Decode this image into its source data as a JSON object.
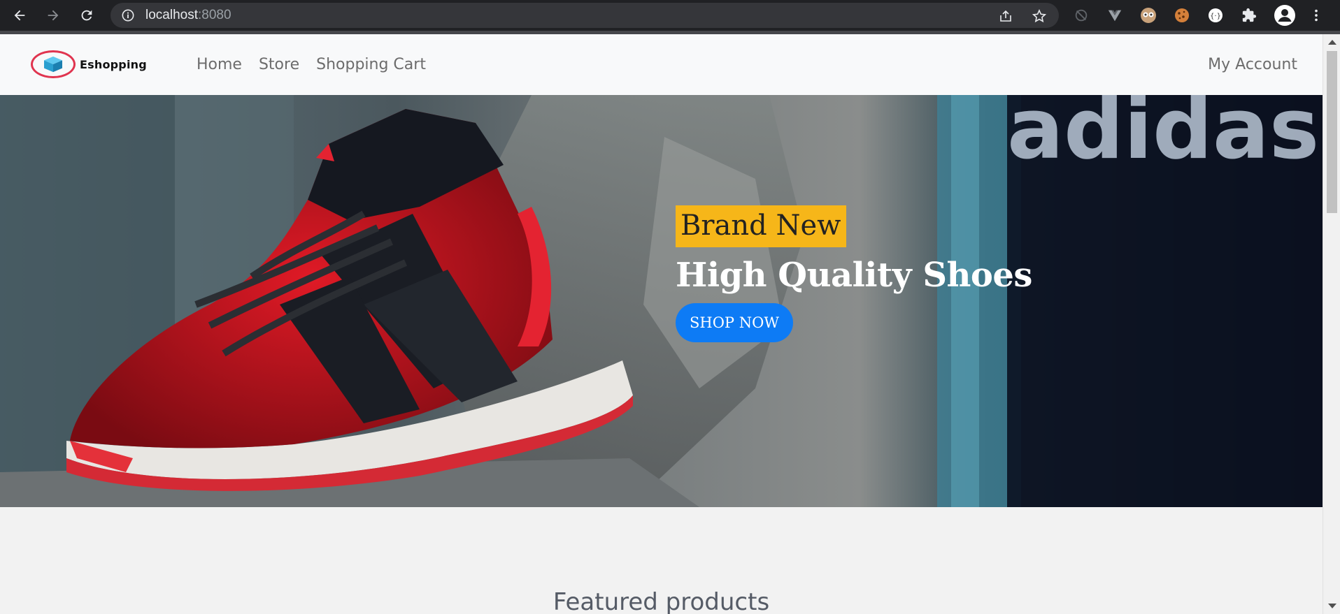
{
  "browser": {
    "url_host": "localhost",
    "url_port": ":8080",
    "icons": [
      "back-icon",
      "forward-icon",
      "reload-icon",
      "info-icon",
      "share-icon",
      "bookmark-star-icon",
      "sync-icon",
      "vue-devtools-icon",
      "extension-icon",
      "cookie-icon",
      "extension-icon",
      "puzzle-icon",
      "profile-icon",
      "menu-icon"
    ]
  },
  "navbar": {
    "brand": "Eshopping",
    "links": [
      "Home",
      "Store",
      "Shopping Cart"
    ],
    "account": "My Account"
  },
  "hero": {
    "badge": "Brand New",
    "title": "High Quality Shoes",
    "button": "SHOP NOW",
    "badge_color": "#f6b619",
    "button_color": "#0d7bf5"
  },
  "section": {
    "title": "Featured products"
  }
}
